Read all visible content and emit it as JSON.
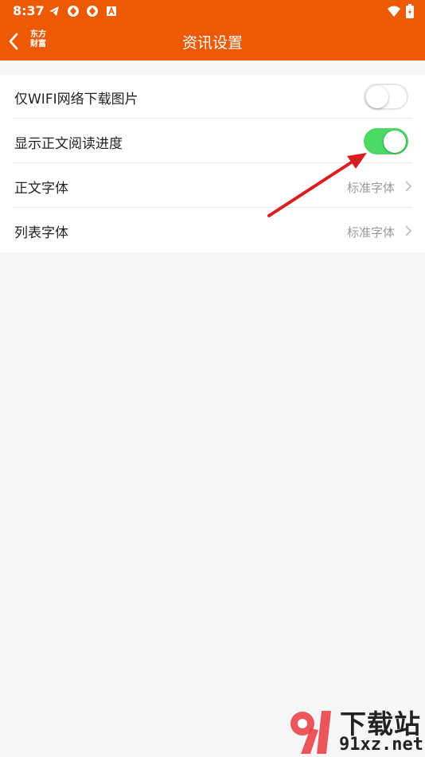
{
  "status_bar": {
    "time": "8:37",
    "icons": [
      "telegram-icon",
      "app-icon",
      "app-icon",
      "a-icon"
    ],
    "right_icons": [
      "wifi-icon",
      "battery-icon"
    ]
  },
  "nav": {
    "title": "资讯设置",
    "brand_line1": "东方",
    "brand_line2": "财富"
  },
  "settings": {
    "items": [
      {
        "label": "仅WIFI网络下载图片",
        "type": "toggle",
        "on": false
      },
      {
        "label": "显示正文阅读进度",
        "type": "toggle",
        "on": true
      },
      {
        "label": "正文字体",
        "type": "link",
        "value": "标准字体"
      },
      {
        "label": "列表字体",
        "type": "link",
        "value": "标准字体"
      }
    ]
  },
  "colors": {
    "brand_orange": "#ec5a06",
    "toggle_on": "#4cd964",
    "page_bg": "#f5f6f8",
    "annotation_arrow": "#d81e1e"
  },
  "watermark": {
    "top_text": "下载站",
    "bottom_text": "91xz.net"
  }
}
